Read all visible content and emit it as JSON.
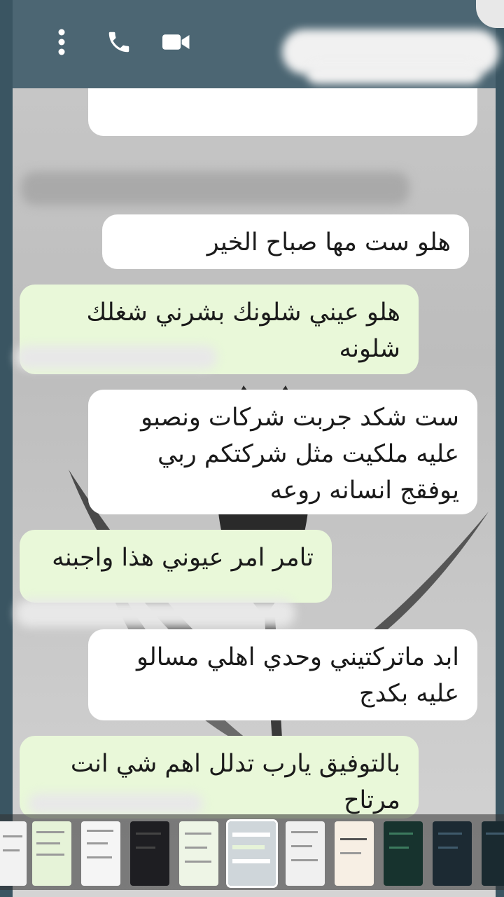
{
  "header": {
    "icons": [
      "more-vert-icon",
      "phone-icon",
      "video-call-icon"
    ]
  },
  "messages": [
    {
      "type": "in",
      "text": "هلو ست مها صباح الخير"
    },
    {
      "type": "out",
      "line1": "هلو عيني شلونك بشرني شغلك",
      "line2": "شلونه"
    },
    {
      "type": "in",
      "line1": "ست شكد جربت شركات ونصبو",
      "line2": "عليه ملكيت مثل شركتكم ربي",
      "line3": "يوفقج انسانه روعه"
    },
    {
      "type": "out",
      "text": "تامر امر عيوني هذا واجبنه"
    },
    {
      "type": "in",
      "line1": "ابد ماتركتيني وحدي اهلي مسالو",
      "line2": "عليه بكدج"
    },
    {
      "type": "out",
      "line1": "بالتوفيق يارب تدلل اهم شي انت",
      "line2": "مرتاح"
    }
  ],
  "colors": {
    "header": "#4c6673",
    "incoming": "#ffffff",
    "outgoing": "#e9f8d9"
  }
}
